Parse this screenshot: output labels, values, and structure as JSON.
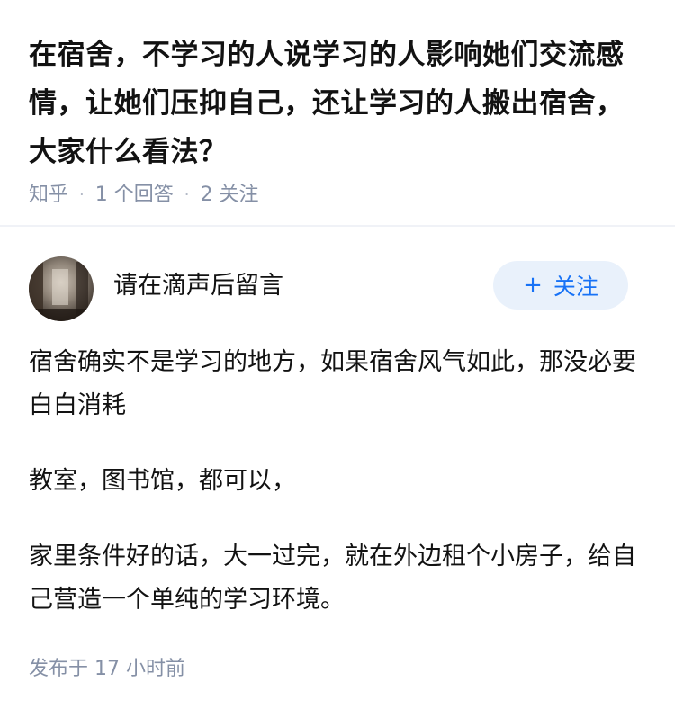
{
  "question": {
    "title": "在宿舍，不学习的人说学习的人影响她们交流感情，让她们压抑自己，还让学习的人搬出宿舍，大家什么看法？",
    "source": "知乎",
    "answer_count": "1 个回答",
    "follow_count": "2 关注"
  },
  "answer": {
    "author_name": "请在滴声后留言",
    "follow_button": "关注",
    "follow_icon": "plus-icon",
    "paragraphs": [
      "宿舍确实不是学习的地方，如果宿舍风气如此，那没必要白白消耗",
      "教室，图书馆，都可以，",
      "家里条件好的话，大一过完，就在外边租个小房子，给自己营造一个单纯的学习环境。"
    ],
    "published": "发布于 17 小时前"
  },
  "colors": {
    "accent": "#1772f6",
    "follow_bg": "#e9f1fb",
    "meta_text": "#8590a6",
    "text": "#121212"
  }
}
